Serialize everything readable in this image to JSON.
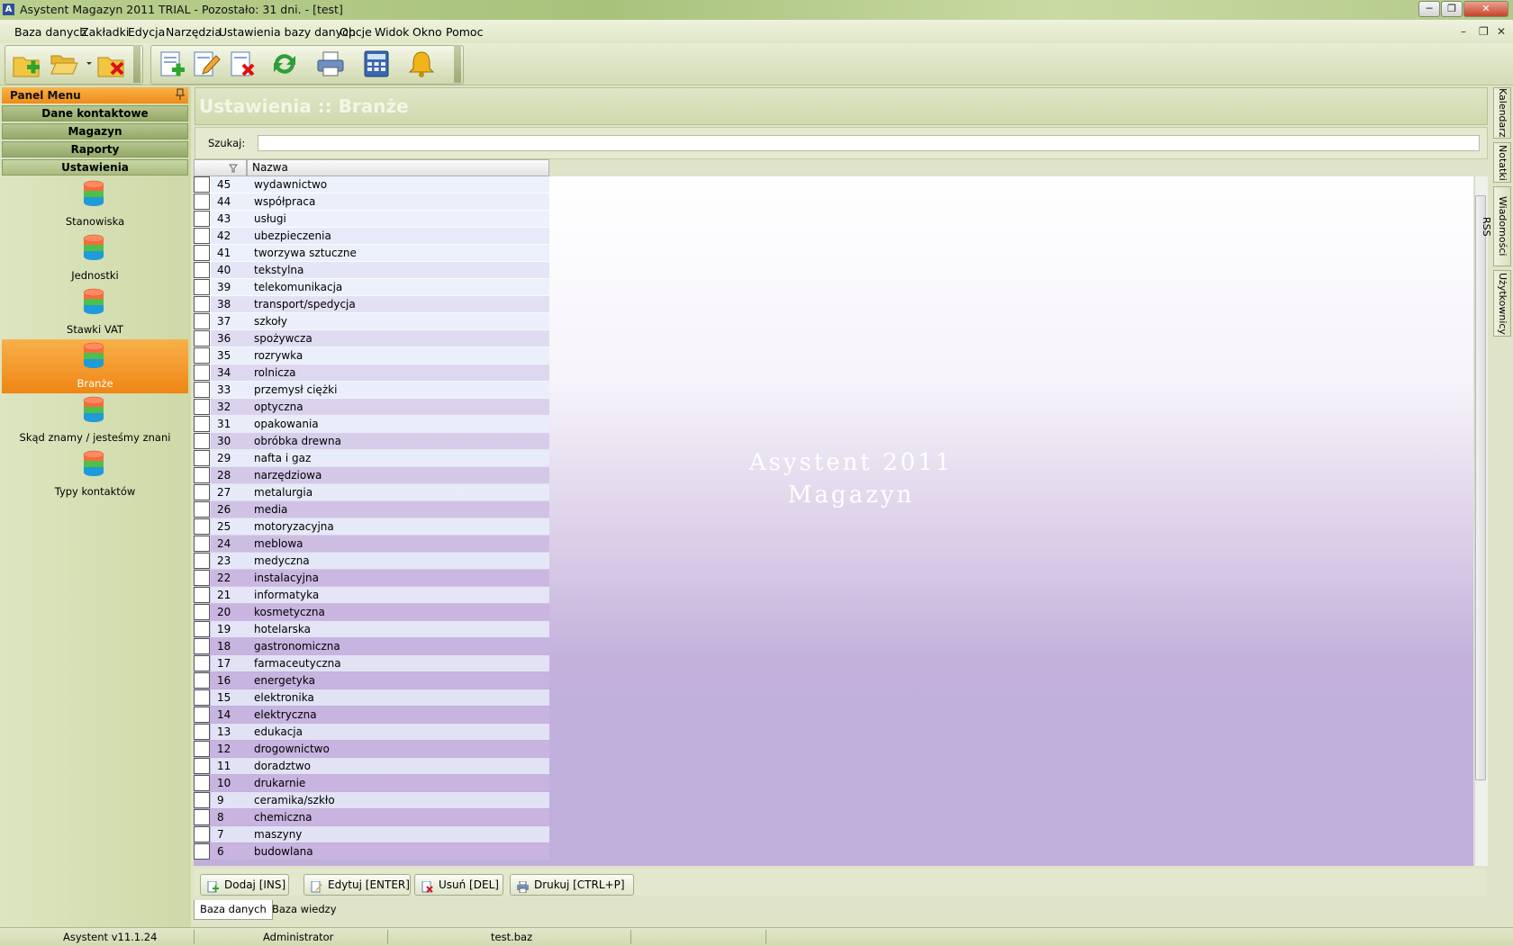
{
  "window": {
    "title": "Asystent Magazyn 2011 TRIAL - Pozostało: 31 dni. - [test]",
    "app_icon_letter": "A",
    "controls": [
      "─",
      "❐",
      "✕"
    ],
    "mdi_controls": [
      "–",
      "❐",
      "✕"
    ]
  },
  "menu": [
    "Baza danych",
    "Zakładki",
    "Edycja",
    "Narzędzia",
    "Ustawienia bazy danych",
    "Opcje",
    "Widok",
    "Okno",
    "Pomoc"
  ],
  "left_panel": {
    "header": "Panel Menu",
    "pin_icon": "pin-icon",
    "sections": [
      "Dane kontaktowe",
      "Magazyn",
      "Raporty",
      "Ustawienia"
    ],
    "items": [
      {
        "label": "Stanowiska",
        "selected": false
      },
      {
        "label": "Jednostki",
        "selected": false
      },
      {
        "label": "Stawki VAT",
        "selected": false
      },
      {
        "label": "Branże",
        "selected": true
      },
      {
        "label": "Skąd znamy / jesteśmy znani",
        "selected": false
      },
      {
        "label": "Typy kontaktów",
        "selected": false
      }
    ]
  },
  "main": {
    "title": "Ustawienia :: Branże",
    "search_label": "Szukaj:",
    "search_value": "",
    "column_header": "Nazwa",
    "watermark_line1": "Asystent 2011",
    "watermark_line2": "Magazyn",
    "rows": [
      {
        "id": "45",
        "name": "wydawnictwo"
      },
      {
        "id": "44",
        "name": "współpraca"
      },
      {
        "id": "43",
        "name": "usługi"
      },
      {
        "id": "42",
        "name": "ubezpieczenia"
      },
      {
        "id": "41",
        "name": "tworzywa sztuczne"
      },
      {
        "id": "40",
        "name": "tekstylna"
      },
      {
        "id": "39",
        "name": "telekomunikacja"
      },
      {
        "id": "38",
        "name": "transport/spedycja"
      },
      {
        "id": "37",
        "name": "szkoły"
      },
      {
        "id": "36",
        "name": "spożywcza"
      },
      {
        "id": "35",
        "name": "rozrywka"
      },
      {
        "id": "34",
        "name": "rolnicza"
      },
      {
        "id": "33",
        "name": "przemysł ciężki"
      },
      {
        "id": "32",
        "name": "optyczna"
      },
      {
        "id": "31",
        "name": "opakowania"
      },
      {
        "id": "30",
        "name": "obróbka drewna"
      },
      {
        "id": "29",
        "name": "nafta i gaz"
      },
      {
        "id": "28",
        "name": "narzędziowa"
      },
      {
        "id": "27",
        "name": "metalurgia"
      },
      {
        "id": "26",
        "name": "media"
      },
      {
        "id": "25",
        "name": "motoryzacyjna"
      },
      {
        "id": "24",
        "name": "meblowa"
      },
      {
        "id": "23",
        "name": "medyczna"
      },
      {
        "id": "22",
        "name": "instalacyjna"
      },
      {
        "id": "21",
        "name": "informatyka"
      },
      {
        "id": "20",
        "name": "kosmetyczna"
      },
      {
        "id": "19",
        "name": "hotelarska"
      },
      {
        "id": "18",
        "name": "gastronomiczna"
      },
      {
        "id": "17",
        "name": "farmaceutyczna"
      },
      {
        "id": "16",
        "name": "energetyka"
      },
      {
        "id": "15",
        "name": "elektronika"
      },
      {
        "id": "14",
        "name": "elektryczna"
      },
      {
        "id": "13",
        "name": "edukacja"
      },
      {
        "id": "12",
        "name": "drogownictwo"
      },
      {
        "id": "11",
        "name": "doradztwo"
      },
      {
        "id": "10",
        "name": "drukarnie"
      },
      {
        "id": "9",
        "name": "ceramika/szkło"
      },
      {
        "id": "8",
        "name": "chemiczna"
      },
      {
        "id": "7",
        "name": "maszyny"
      },
      {
        "id": "6",
        "name": "budowlana"
      }
    ],
    "buttons": [
      {
        "label": "Dodaj [INS]",
        "icon": "add-icon"
      },
      {
        "label": "Edytuj [ENTER]",
        "icon": "edit-icon"
      },
      {
        "label": "Usuń [DEL]",
        "icon": "delete-icon"
      },
      {
        "label": "Drukuj [CTRL+P]",
        "icon": "print-icon"
      }
    ],
    "tabs": [
      "Baza danych",
      "Baza wiedzy"
    ]
  },
  "right_tabs": [
    "Kalendarz",
    "Notatki",
    "Wiadomości RSS",
    "Użytkownicy"
  ],
  "statusbar": {
    "version": "Asystent v11.1.24",
    "user": "Administrator",
    "file": "test.baz"
  },
  "colors": {
    "accent_orange": "#f08a17",
    "row_light": "#eaf1fb",
    "row_purple": "#c8b3df"
  }
}
